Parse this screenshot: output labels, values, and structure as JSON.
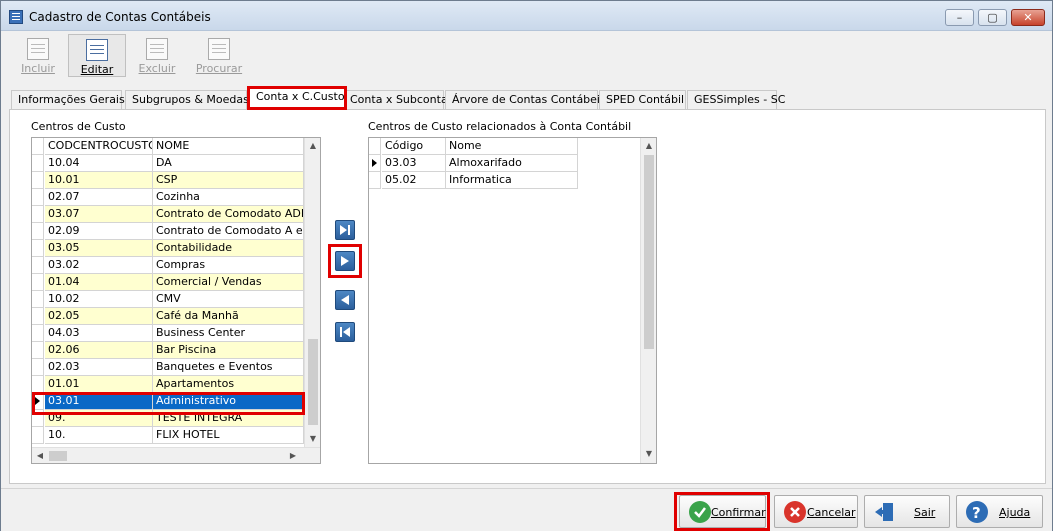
{
  "window": {
    "title": "Cadastro de Contas Contábeis",
    "buttons": [
      "–",
      "▢",
      "✕"
    ]
  },
  "toolbar": {
    "buttons": [
      {
        "label": "Incluir",
        "enabled": false,
        "icon": "new-document-icon"
      },
      {
        "label": "Editar",
        "enabled": true,
        "icon": "edit-document-icon"
      },
      {
        "label": "Excluir",
        "enabled": false,
        "icon": "delete-document-icon"
      },
      {
        "label": "Procurar",
        "enabled": false,
        "icon": "search-document-icon"
      }
    ]
  },
  "tabs": [
    {
      "label": "Informações Gerais"
    },
    {
      "label": "Subgrupos & Moedas"
    },
    {
      "label": "Conta x C.Custo",
      "active": true
    },
    {
      "label": "Conta x Subconta"
    },
    {
      "label": "Árvore de Contas Contábeis"
    },
    {
      "label": "SPED Contábil"
    },
    {
      "label": "GESSimples - SC"
    }
  ],
  "left_panel": {
    "title": "Centros de Custo",
    "columns": [
      "CODCENTROCUSTO",
      "NOME"
    ],
    "rows": [
      [
        "10.04",
        "DA"
      ],
      [
        "10.01",
        "CSP"
      ],
      [
        "02.07",
        "Cozinha"
      ],
      [
        "03.07",
        "Contrato de Comodato ADM"
      ],
      [
        "02.09",
        "Contrato de Comodato A e B"
      ],
      [
        "03.05",
        "Contabilidade"
      ],
      [
        "03.02",
        "Compras"
      ],
      [
        "01.04",
        "Comercial / Vendas"
      ],
      [
        "10.02",
        "CMV"
      ],
      [
        "02.05",
        "Café da Manhã"
      ],
      [
        "04.03",
        "Business Center"
      ],
      [
        "02.06",
        "Bar Piscina"
      ],
      [
        "02.03",
        "Banquetes e Eventos"
      ],
      [
        "01.01",
        "Apartamentos"
      ],
      [
        "03.01",
        "Administrativo"
      ],
      [
        "09.",
        "TESTE INTEGRA"
      ],
      [
        "10.",
        "FLIX HOTEL"
      ]
    ],
    "selected_index": 14
  },
  "move_buttons": [
    {
      "name": "move-all-right",
      "icon": "move-all-right-icon"
    },
    {
      "name": "move-right",
      "icon": "move-right-icon"
    },
    {
      "name": "move-left",
      "icon": "move-left-icon"
    },
    {
      "name": "move-all-left",
      "icon": "move-all-left-icon"
    }
  ],
  "right_panel": {
    "title": "Centros de Custo relacionados à Conta Contábil",
    "columns": [
      "Código",
      "Nome"
    ],
    "rows": [
      [
        "03.03",
        "Almoxarifado"
      ],
      [
        "05.02",
        "Informatica"
      ]
    ]
  },
  "bottom_buttons": [
    {
      "label": "Confirmar",
      "icon": "check-icon",
      "color": "#3aa34a"
    },
    {
      "label": "Cancelar",
      "icon": "cancel-icon",
      "color": "#d9342b"
    },
    {
      "label": "Sair",
      "icon": "exit-door-icon",
      "color": "#2d6cb5"
    },
    {
      "label": "Ajuda",
      "icon": "help-icon",
      "color": "#2d6cb5"
    }
  ],
  "colors": {
    "highlight_red": "#e00000",
    "row_alt": "#ffffd0",
    "selection": "#0a68c6"
  }
}
